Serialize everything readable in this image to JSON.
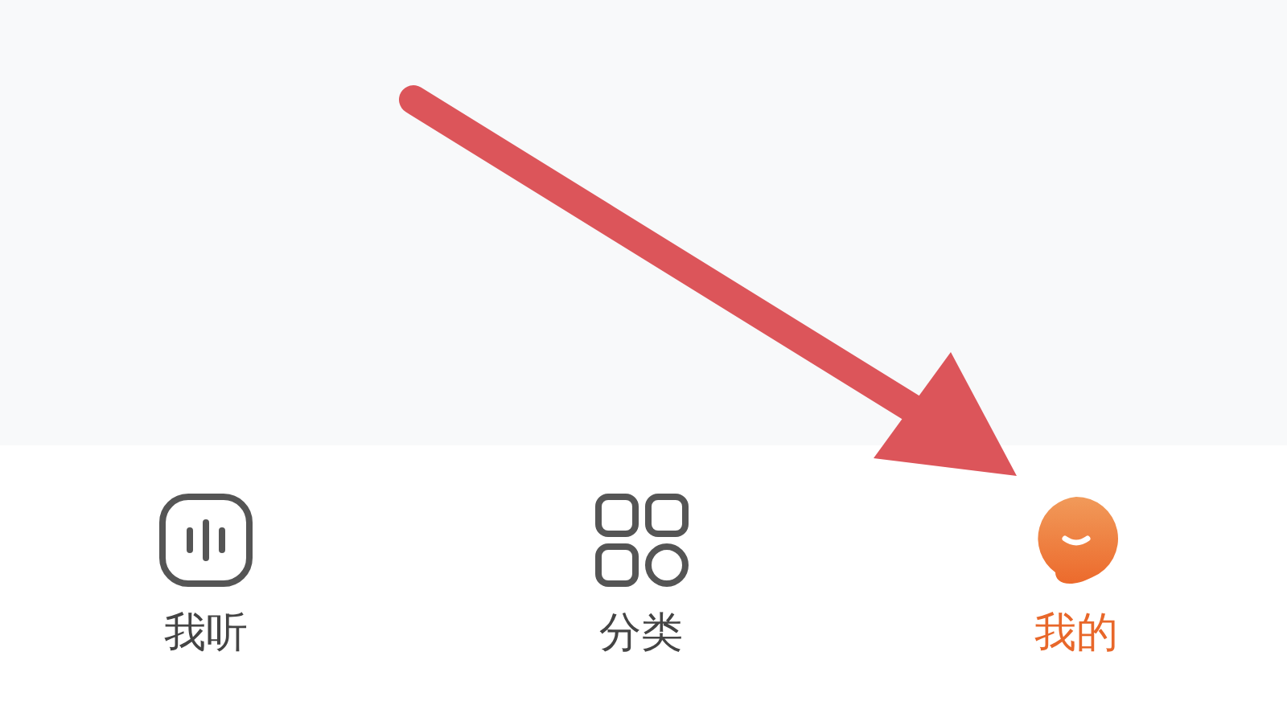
{
  "tabs": [
    {
      "label": "我听",
      "kind": "listen",
      "selected": false
    },
    {
      "label": "分类",
      "kind": "category",
      "selected": false
    },
    {
      "label": "我的",
      "kind": "mine",
      "selected": true
    }
  ]
}
